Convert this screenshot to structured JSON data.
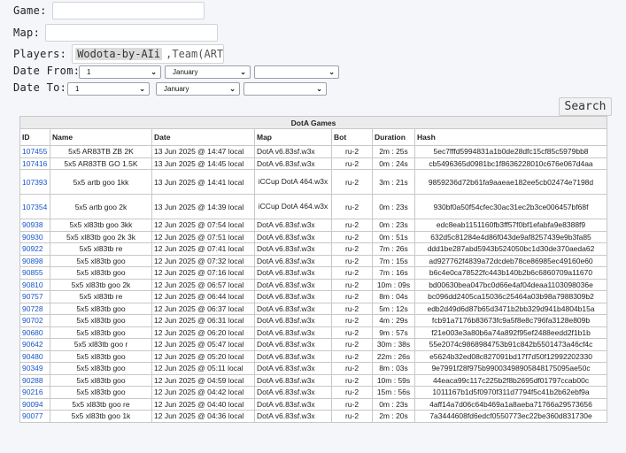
{
  "form": {
    "game_label": "Game:",
    "map_label": "Map:",
    "players_label": "Players:",
    "players_highlight": "Wodota-by-AIi",
    "players_rest": ",Team(ARTB",
    "date_from_label": "Date From:",
    "date_to_label": "Date To:",
    "from_day": "1",
    "from_month": "January",
    "from_year": "",
    "to_day": "1",
    "to_month": "January",
    "to_year": "",
    "search_label": "Search"
  },
  "table": {
    "caption": "DotA Games",
    "columns": [
      "ID",
      "Name",
      "Date",
      "Map",
      "Bot",
      "Duration",
      "Hash"
    ],
    "rows": [
      {
        "id": "107455",
        "name": "5x5 AR83TB ZB 2K",
        "date": "13 Jun 2025 @ 14:47 local",
        "map": "DotA v6.83sf.w3x",
        "bot": "ru-2",
        "duration": "2m : 25s",
        "hash": "5ec7fffd5994831a1b0de28dfc15cf85c5979bb8"
      },
      {
        "id": "107416",
        "name": "5x5 AR83TB GO 1.5K",
        "date": "13 Jun 2025 @ 14:45 local",
        "map": "DotA v6.83sf.w3x",
        "bot": "ru-2",
        "duration": "0m : 24s",
        "hash": "cb5496365d0981bc1f8636228010c676e067d4aa"
      },
      {
        "id": "107393",
        "name": "5x5 artb goo 1kk",
        "date": "13 Jun 2025 @ 14:41 local",
        "map": "iCCup DotA 464.w3x",
        "bot": "ru-2",
        "duration": "3m : 21s",
        "hash": "9859236d72b61fa9aaeae182ee5cb02474e7198d",
        "tall": true
      },
      {
        "id": "107354",
        "name": "5x5 artb goo 2k",
        "date": "13 Jun 2025 @ 14:39 local",
        "map": "iCCup DotA 464.w3x",
        "bot": "ru-2",
        "duration": "0m : 23s",
        "hash": "930bf0a50f54cfec30ac31ec2b3ce006457bf68f",
        "tall": true
      },
      {
        "id": "90938",
        "name": "5x5 xl83tb goo 3kk",
        "date": "12 Jun 2025 @ 07:54 local",
        "map": "DotA v6.83sf.w3x",
        "bot": "ru-2",
        "duration": "0m : 23s",
        "hash": "edc8eab1151160fb3ff57f0bf1efabfa9e8388f9"
      },
      {
        "id": "90930",
        "name": "5x5 xl83tb goo 2k 3k",
        "date": "12 Jun 2025 @ 07:51 local",
        "map": "DotA v6.83sf.w3x",
        "bot": "ru-2",
        "duration": "0m : 51s",
        "hash": "632d5c81284e4d86f043de9af8257439e9b3fa85"
      },
      {
        "id": "90922",
        "name": "5x5 xl83tb re",
        "date": "12 Jun 2025 @ 07:41 local",
        "map": "DotA v6.83sf.w3x",
        "bot": "ru-2",
        "duration": "7m : 26s",
        "hash": "ddd1be287abd5943b524050bc1d30de370aeda62"
      },
      {
        "id": "90898",
        "name": "5x5 xl83tb goo",
        "date": "12 Jun 2025 @ 07:32 local",
        "map": "DotA v6.83sf.w3x",
        "bot": "ru-2",
        "duration": "7m : 15s",
        "hash": "ad927762f4839a72dcdeb78ce86985ec49160e60"
      },
      {
        "id": "90855",
        "name": "5x5 xl83tb goo",
        "date": "12 Jun 2025 @ 07:16 local",
        "map": "DotA v6.83sf.w3x",
        "bot": "ru-2",
        "duration": "7m : 16s",
        "hash": "b6c4e0ca78522fc443b140b2b6c6860709a11670"
      },
      {
        "id": "90810",
        "name": "5x5 xl83tb goo 2k",
        "date": "12 Jun 2025 @ 06:57 local",
        "map": "DotA v6.83sf.w3x",
        "bot": "ru-2",
        "duration": "10m : 09s",
        "hash": "bd00630bea047bc0d66e4af04deaa1103098036e"
      },
      {
        "id": "90757",
        "name": "5x5 xl83tb re",
        "date": "12 Jun 2025 @ 06:44 local",
        "map": "DotA v6.83sf.w3x",
        "bot": "ru-2",
        "duration": "8m : 04s",
        "hash": "bc096dd2405ca15036c25464a03b98a7988309b2"
      },
      {
        "id": "90728",
        "name": "5x5 xl83tb goo",
        "date": "12 Jun 2025 @ 06:37 local",
        "map": "DotA v6.83sf.w3x",
        "bot": "ru-2",
        "duration": "5m : 12s",
        "hash": "edb2d49d6d87b65d3471b2bb329d941b4804b15a"
      },
      {
        "id": "90702",
        "name": "5x5 xl83tb goo",
        "date": "12 Jun 2025 @ 06:31 local",
        "map": "DotA v6.83sf.w3x",
        "bot": "ru-2",
        "duration": "4m : 29s",
        "hash": "fcb91a7176b83673fc9a5f8e8c796fa3128e809b"
      },
      {
        "id": "90680",
        "name": "5x5 xl83tb goo",
        "date": "12 Jun 2025 @ 06:20 local",
        "map": "DotA v6.83sf.w3x",
        "bot": "ru-2",
        "duration": "9m : 57s",
        "hash": "f21e003e3a80b6a74a892f95ef2488eedd2f1b1b"
      },
      {
        "id": "90642",
        "name": "5x5 xl83tb goo r",
        "date": "12 Jun 2025 @ 05:47 local",
        "map": "DotA v6.83sf.w3x",
        "bot": "ru-2",
        "duration": "30m : 38s",
        "hash": "55e2074c9868984753b91c842b5501473a46cf4c"
      },
      {
        "id": "90480",
        "name": "5x5 xl83tb goo",
        "date": "12 Jun 2025 @ 05:20 local",
        "map": "DotA v6.83sf.w3x",
        "bot": "ru-2",
        "duration": "22m : 26s",
        "hash": "e5624b32ed08c827091bd17f7d50f12992202330"
      },
      {
        "id": "90349",
        "name": "5x5 xl83tb goo",
        "date": "12 Jun 2025 @ 05:11 local",
        "map": "DotA v6.83sf.w3x",
        "bot": "ru-2",
        "duration": "8m : 03s",
        "hash": "9e7991f28f975b99003498905848175095ae50c"
      },
      {
        "id": "90288",
        "name": "5x5 xl83tb goo",
        "date": "12 Jun 2025 @ 04:59 local",
        "map": "DotA v6.83sf.w3x",
        "bot": "ru-2",
        "duration": "10m : 59s",
        "hash": "44eaca99c117c225b2f8b2695df01797ccab00c"
      },
      {
        "id": "90216",
        "name": "5x5 xl83tb goo",
        "date": "12 Jun 2025 @ 04:42 local",
        "map": "DotA v6.83sf.w3x",
        "bot": "ru-2",
        "duration": "15m : 56s",
        "hash": "1011167b1d5f0970f311d7794f5c41b2b62ebf9a"
      },
      {
        "id": "90094",
        "name": "5x5 xl83tb goo re",
        "date": "12 Jun 2025 @ 04:40 local",
        "map": "DotA v6.83sf.w3x",
        "bot": "ru-2",
        "duration": "0m : 23s",
        "hash": "4aff14a7d06c64b469a1a8aeba71766a29573656"
      },
      {
        "id": "90077",
        "name": "5x5 xl83tb goo 1k",
        "date": "12 Jun 2025 @ 04:36 local",
        "map": "DotA v6.83sf.w3x",
        "bot": "ru-2",
        "duration": "2m : 20s",
        "hash": "7a3444608fd6edcf0550773ec22be360d831730e"
      }
    ]
  }
}
